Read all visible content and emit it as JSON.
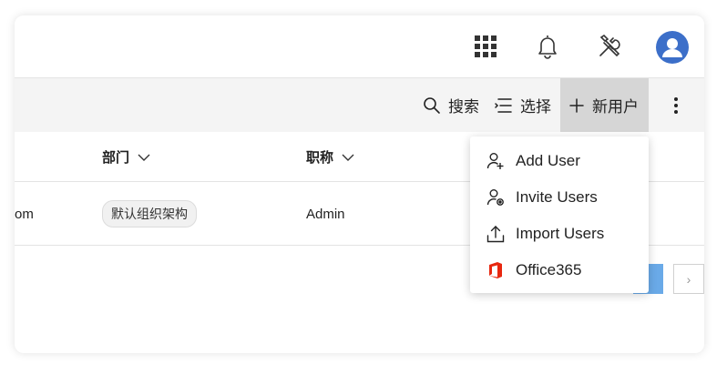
{
  "toolbar": {
    "search_label": "搜索",
    "select_label": "选择",
    "new_user_label": "新用户"
  },
  "table": {
    "columns": [
      {
        "label": "部门"
      },
      {
        "label": "职称"
      }
    ],
    "rows": [
      {
        "email_fragment": "om",
        "department": "默认组织架构",
        "title": "Admin"
      }
    ]
  },
  "dropdown": {
    "items": [
      {
        "label": "Add User",
        "icon": "add-user-icon"
      },
      {
        "label": "Invite Users",
        "icon": "invite-users-icon"
      },
      {
        "label": "Import Users",
        "icon": "upload-icon"
      },
      {
        "label": "Office365",
        "icon": "office365-icon"
      }
    ]
  },
  "colors": {
    "avatar_bg": "#3c6fc9",
    "pagination_active": "#6aaae8",
    "office365_red": "#e8270f"
  },
  "pagination": {
    "next_symbol": "›"
  }
}
